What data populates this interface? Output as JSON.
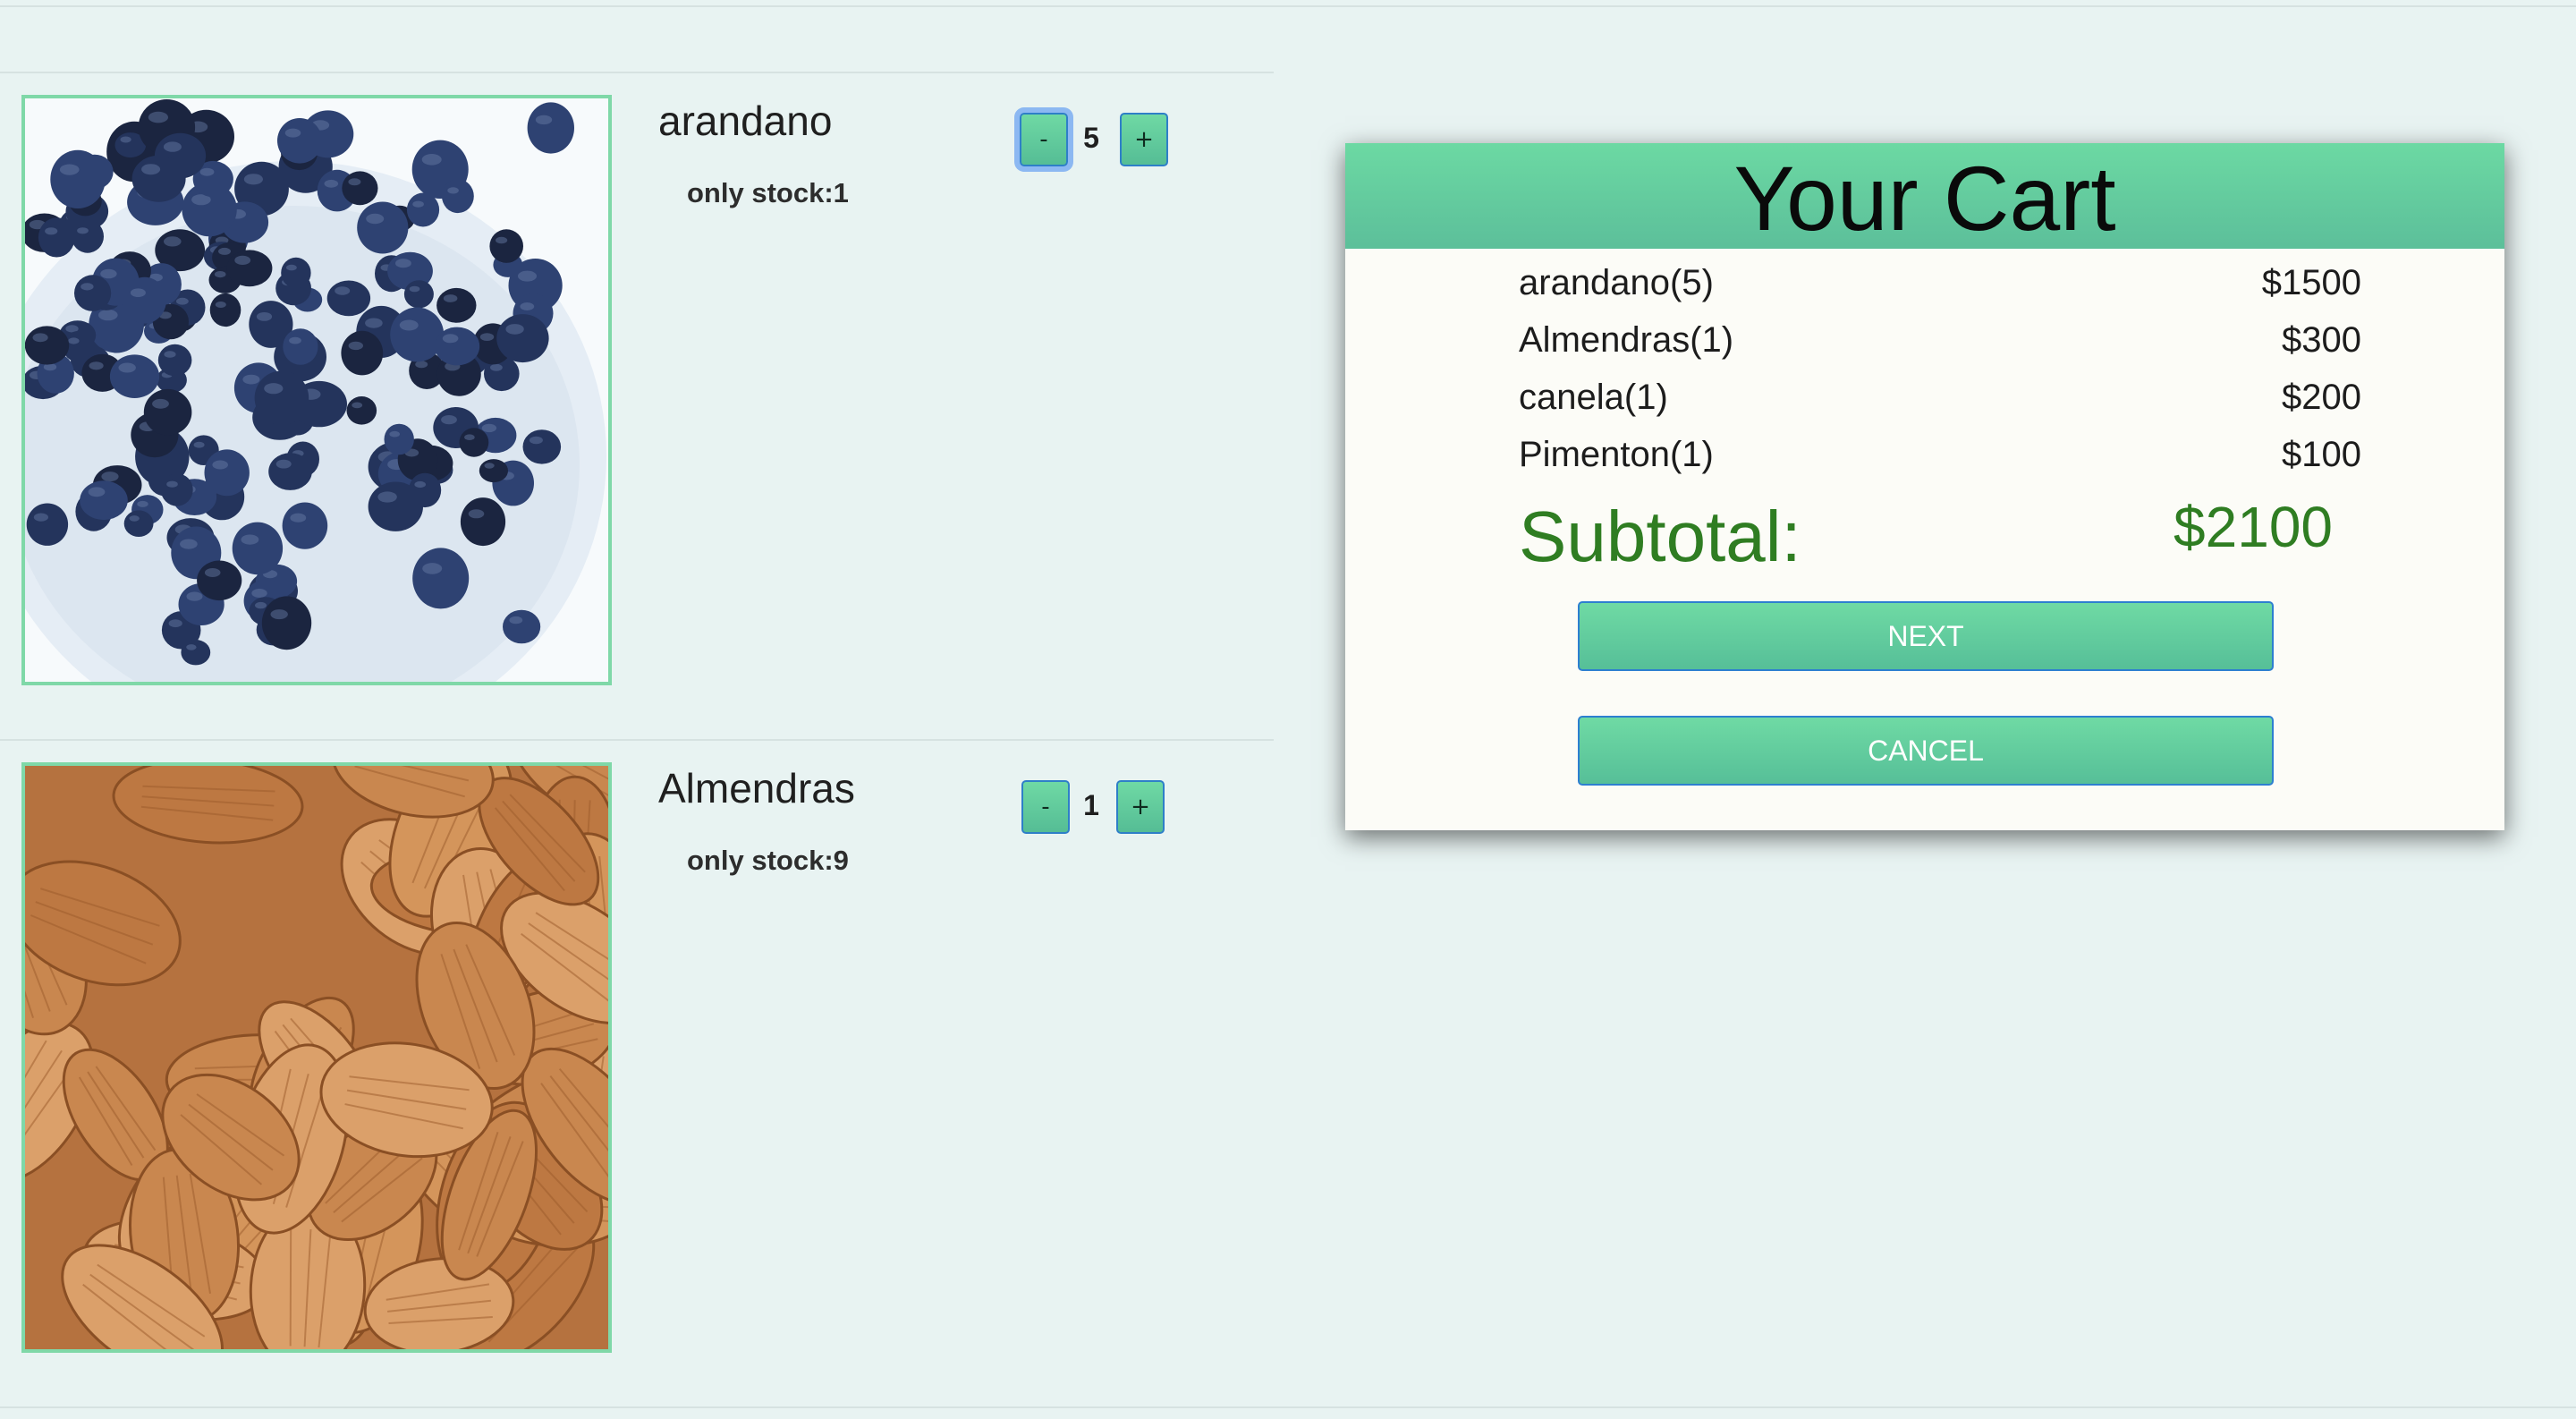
{
  "products": [
    {
      "name": "arandano",
      "stock_label": "only stock:1",
      "quantity": "5",
      "minus_label": "-",
      "plus_label": "+"
    },
    {
      "name": "Almendras",
      "stock_label": "only stock:9",
      "quantity": "1",
      "minus_label": "-",
      "plus_label": "+"
    }
  ],
  "cart": {
    "title": "Your Cart",
    "items": [
      {
        "label": "arandano(5)",
        "price": "$1500"
      },
      {
        "label": "Almendras(1)",
        "price": "$300"
      },
      {
        "label": "canela(1)",
        "price": "$200"
      },
      {
        "label": "Pimenton(1)",
        "price": "$100"
      }
    ],
    "subtotal_label": "Subtotal:",
    "subtotal_value": "$2100",
    "next_label": "NEXT",
    "cancel_label": "CANCEL"
  },
  "colors": {
    "page_background": "#e8f3f2",
    "accent_green": "#6cd9a3",
    "subtotal_green": "#2f7d22",
    "button_border_blue": "#2d7fd0"
  }
}
